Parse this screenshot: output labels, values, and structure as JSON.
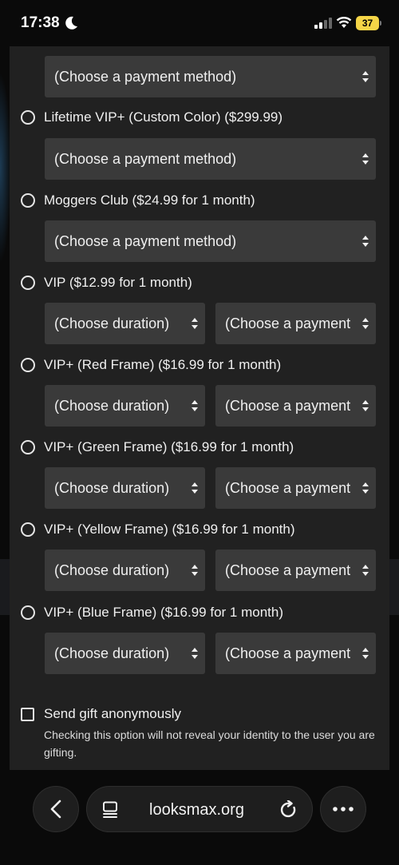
{
  "status_bar": {
    "time": "17:38",
    "battery": "37"
  },
  "options": [
    {
      "label": "Lifetime VIP+ (Custom Color) ($299.99)"
    },
    {
      "label": "Moggers Club ($24.99 for 1 month)"
    },
    {
      "label": "VIP ($12.99 for 1 month)"
    },
    {
      "label": "VIP+ (Red Frame) ($16.99 for 1 month)"
    },
    {
      "label": "VIP+ (Green Frame) ($16.99 for 1 month)"
    },
    {
      "label": "VIP+ (Yellow Frame) ($16.99 for 1 month)"
    },
    {
      "label": "VIP+ (Blue Frame) ($16.99 for 1 month)"
    }
  ],
  "selects": {
    "payment_full": "(Choose a payment method)",
    "duration": "(Choose duration)",
    "payment_short": "(Choose a payment"
  },
  "anonymous": {
    "label": "Send gift anonymously",
    "description": "Checking this option will not reveal your identity to the user you are gifting."
  },
  "browser": {
    "url": "looksmax.org"
  }
}
